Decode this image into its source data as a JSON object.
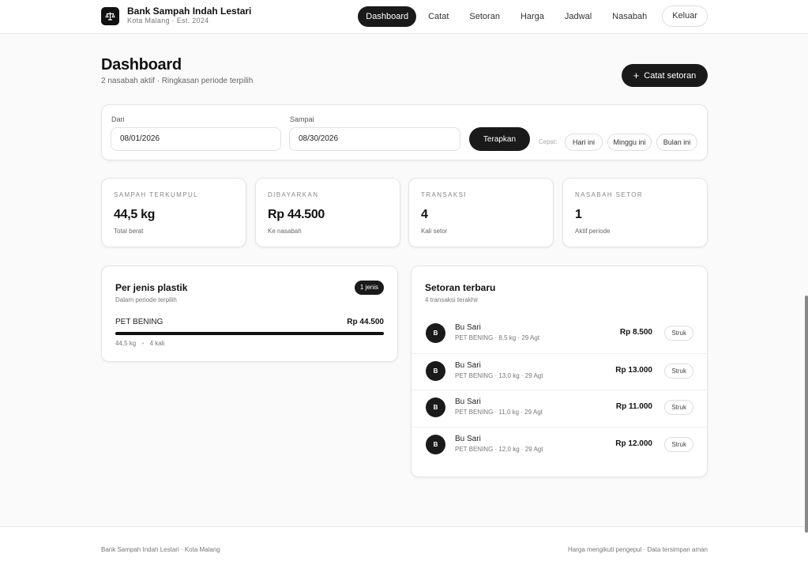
{
  "brand": {
    "name": "Bank Sampah Indah Lestari",
    "subtitle": "Kota Malang · Est. 2024",
    "logo_icon": "scale-icon"
  },
  "nav": {
    "items": [
      {
        "label": "Dashboard",
        "active": true
      },
      {
        "label": "Catat"
      },
      {
        "label": "Setoran"
      },
      {
        "label": "Harga"
      },
      {
        "label": "Jadwal"
      },
      {
        "label": "Nasabah"
      }
    ],
    "logout": "Keluar"
  },
  "page": {
    "title": "Dashboard",
    "subtitle": "2 nasabah aktif · Ringkasan periode terpilih",
    "primary_button": "Catat setoran",
    "primary_button_icon": "plus-icon"
  },
  "filter": {
    "from_label": "Dari",
    "from_value": "08/01/2026",
    "to_label": "Sampai",
    "to_value": "08/30/2026",
    "apply": "Terapkan",
    "quick_label": "Cepat:",
    "quick": [
      "Hari ini",
      "Minggu ini",
      "Bulan ini"
    ]
  },
  "stats": [
    {
      "label": "SAMPAH TERKUMPUL",
      "value": "44,5 kg",
      "caption": "Total berat"
    },
    {
      "label": "DIBAYARKAN",
      "value": "Rp 44.500",
      "caption": "Ke nasabah"
    },
    {
      "label": "TRANSAKSI",
      "value": "4",
      "caption": "Kali setor"
    },
    {
      "label": "NASABAH SETOR",
      "value": "1",
      "caption": "Aktif periode"
    }
  ],
  "plastic": {
    "title": "Per jenis plastik",
    "subtitle": "Dalam periode terpilih",
    "badge": "1 jenis",
    "types": [
      {
        "name": "PET BENING",
        "amount": "Rp 44.500",
        "share": 1.0,
        "weight": "44,5 kg",
        "count": "4 kali"
      }
    ]
  },
  "recent": {
    "title": "Setoran terbaru",
    "subtitle": "4 transaksi terakhir",
    "items": [
      {
        "initial": "B",
        "name": "Bu Sari",
        "detail": "PET BENING · 8,5 kg · 29 Agt",
        "amount": "Rp 8.500",
        "action": "Struk"
      },
      {
        "initial": "B",
        "name": "Bu Sari",
        "detail": "PET BENING · 13,0 kg · 29 Agt",
        "amount": "Rp 13.000",
        "action": "Struk"
      },
      {
        "initial": "B",
        "name": "Bu Sari",
        "detail": "PET BENING · 11,0 kg · 29 Agt",
        "amount": "Rp 11.000",
        "action": "Struk"
      },
      {
        "initial": "B",
        "name": "Bu Sari",
        "detail": "PET BENING · 12,0 kg · 29 Agt",
        "amount": "Rp 12.000",
        "action": "Struk"
      }
    ]
  },
  "footer": {
    "left": "Bank Sampah Indah Lestari · Kota Malang",
    "right": "Harga mengikuti pengepul · Data tersimpan aman"
  },
  "colors": {
    "accent": "#1a1a1a",
    "background": "#fafafa",
    "card": "#ffffff"
  }
}
